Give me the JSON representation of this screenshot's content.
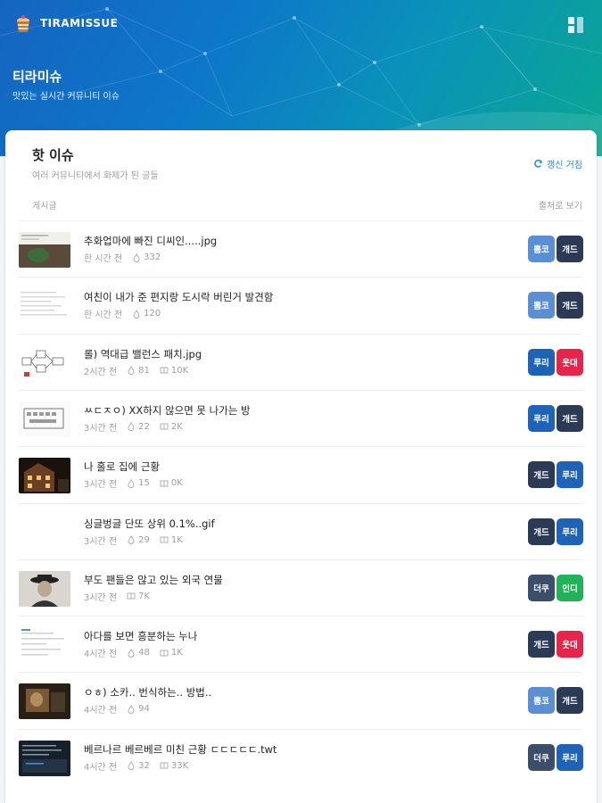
{
  "header": {
    "app_name": "TIRAMISSUE",
    "title": "티라미슈",
    "subtitle": "맛있는 실시간 커뮤니티 이슈"
  },
  "card": {
    "title": "핫 이슈",
    "subtitle": "여러 커뮤니티에서 화제가 된 글들",
    "refresh_label": "갱신 거침",
    "col_left": "게시글",
    "col_right": "출처로 보기"
  },
  "colors": {
    "뽐코": "#5a8fd6",
    "개드": "#2b3a55",
    "루리": "#1e63b8",
    "웃대": "#e8244a",
    "더쿠": "#3b4f6b",
    "인디": "#22b35a"
  },
  "posts": [
    {
      "title": "추화업마에 빠진 디씨인.....jpg",
      "time": "한 시간 전",
      "likes": "332",
      "views": "",
      "thumb": "dark-green",
      "tags": [
        "뽐코",
        "개드"
      ]
    },
    {
      "title": "여친이 내가 준 편지랑 도시락 버린거 발견함",
      "time": "한 시간 전",
      "likes": "120",
      "views": "",
      "thumb": "text-doc",
      "tags": [
        "뽐코",
        "개드"
      ]
    },
    {
      "title": "롤) 역대급 밸런스 패치.jpg",
      "time": "2시간 전",
      "likes": "81",
      "views": "10K",
      "thumb": "diagram",
      "tags": [
        "루리",
        "웃대"
      ]
    },
    {
      "title": "ㅆㄷㅈㅇ) XX하지 않으면 못 나가는 방",
      "time": "3시간 전",
      "likes": "22",
      "views": "2K",
      "thumb": "keyboard",
      "tags": [
        "루리",
        "개드"
      ]
    },
    {
      "title": "나 홀로 집에 근황",
      "time": "3시간 전",
      "likes": "15",
      "views": "0K",
      "thumb": "house",
      "tags": [
        "개드",
        "루리"
      ]
    },
    {
      "title": "싱글벙글 단또 상위 0.1%..gif",
      "time": "3시간 전",
      "likes": "29",
      "views": "1K",
      "thumb": "none",
      "tags": [
        "개드",
        "루리"
      ]
    },
    {
      "title": "부도 팬들은 많고 있는 외국 연물",
      "time": "3시간 전",
      "likes": "",
      "views": "7K",
      "thumb": "portrait",
      "tags": [
        "더쿠",
        "인디"
      ]
    },
    {
      "title": "아다를 보면 흥분하는 누나",
      "time": "4시간 전",
      "likes": "48",
      "views": "1K",
      "thumb": "text-doc2",
      "tags": [
        "개드",
        "웃대"
      ]
    },
    {
      "title": "ㅇㅎ) 소카.. 번식하는.. 방법..",
      "time": "4시간 전",
      "likes": "94",
      "views": "",
      "thumb": "photo",
      "tags": [
        "뽐코",
        "개드"
      ]
    },
    {
      "title": "베르나르 베르베르 미친 근황 ㄷㄷㄷㄷㄷ.twt",
      "time": "4시간 전",
      "likes": "32",
      "views": "33K",
      "thumb": "tweet",
      "tags": [
        "더쿠",
        "루리"
      ]
    }
  ]
}
